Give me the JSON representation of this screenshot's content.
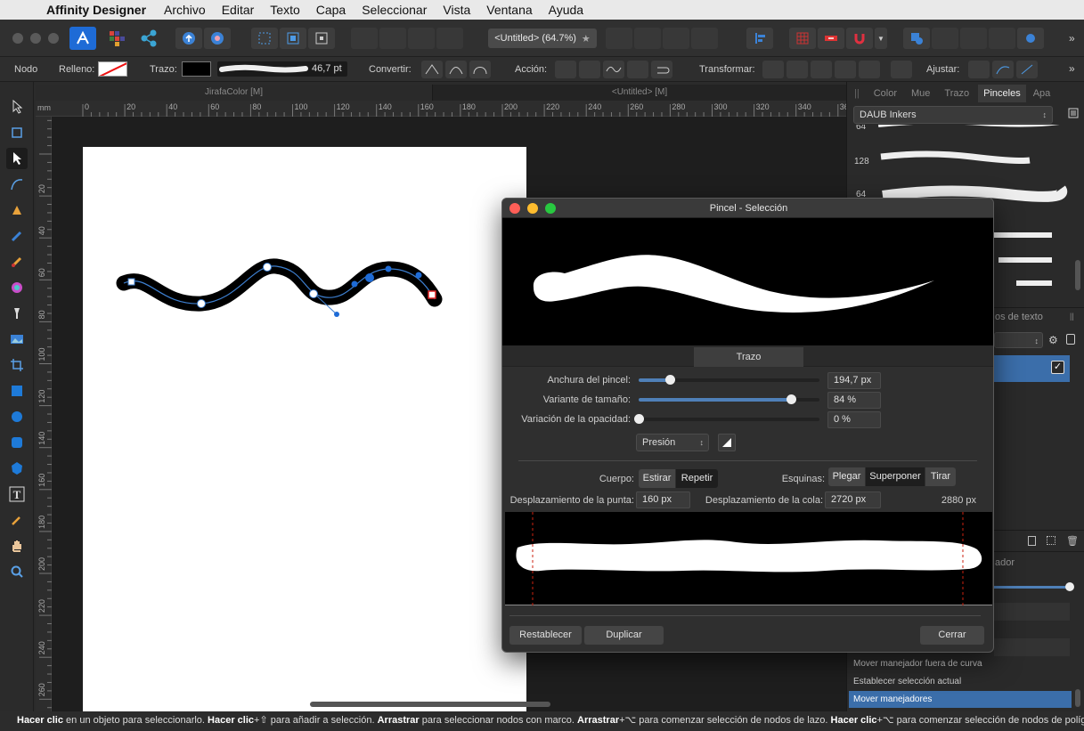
{
  "menubar": {
    "app": "Affinity Designer",
    "items": [
      "Archivo",
      "Editar",
      "Texto",
      "Capa",
      "Seleccionar",
      "Vista",
      "Ventana",
      "Ayuda"
    ]
  },
  "toolbar": {
    "document_tab": "<Untitled> (64.7%)"
  },
  "context_bar": {
    "node_label": "Nodo",
    "fill_label": "Relleno:",
    "stroke_label": "Trazo:",
    "stroke_width": "46,7 pt",
    "convert_label": "Convertir:",
    "action_label": "Acción:",
    "transform_label": "Transformar:",
    "snap_label": "Ajustar:"
  },
  "document_tabs": [
    "JirafaColor [M]",
    "<Untitled> [M]"
  ],
  "ruler": {
    "unit": "mm",
    "h_ticks": [
      "0",
      "20",
      "40",
      "60",
      "80",
      "100",
      "120",
      "140",
      "160",
      "180",
      "200",
      "220",
      "240",
      "260",
      "280",
      "300",
      "320",
      "340",
      "36"
    ],
    "v_ticks": [
      "20",
      "40",
      "60",
      "80",
      "100",
      "120",
      "140",
      "160",
      "180",
      "200",
      "220",
      "240",
      "260"
    ]
  },
  "right_panel": {
    "tabs": [
      "Color",
      "Mue",
      "Trazo",
      "Pinceles",
      "Apa"
    ],
    "active_tab": "Pinceles",
    "category": "DAUB Inkers",
    "brush_sizes": [
      "64",
      "128",
      "64"
    ],
    "partial_tab_label": "os de texto",
    "partial_label_2": "ador",
    "history": [
      "Mover manejador fuera de curva",
      "Establecer selección actual",
      "Mover manejadores"
    ]
  },
  "dialog": {
    "title": "Pincel - Selección",
    "tab": "Trazo",
    "brush_width_label": "Anchura del pincel:",
    "brush_width_value": "194,7 px",
    "brush_width_level": 0.17,
    "size_variance_label": "Variante de tamaño:",
    "size_variance_value": "84 %",
    "size_variance_level": 0.84,
    "opacity_variance_label": "Variación de la opacidad:",
    "opacity_variance_value": "0 %",
    "opacity_variance_level": 0.0,
    "pressure": "Presión",
    "body_label": "Cuerpo:",
    "body_options": [
      "Estirar",
      "Repetir"
    ],
    "body_selected": "Repetir",
    "corners_label": "Esquinas:",
    "corners_options": [
      "Plegar",
      "Superponer",
      "Tirar"
    ],
    "corners_selected": "Superponer",
    "head_offset_label": "Desplazamiento de la punta:",
    "head_offset_value": "160 px",
    "tail_offset_label": "Desplazamiento de la cola:",
    "tail_offset_value": "2720 px",
    "total_length": "2880 px",
    "reset_button": "Restablecer",
    "duplicate_button": "Duplicar",
    "close_button": "Cerrar"
  },
  "status": {
    "parts": [
      {
        "b": "Hacer clic",
        "t": " en un objeto para seleccionarlo. "
      },
      {
        "b": "Hacer clic",
        "t": "+⇧ para añadir a selección. "
      },
      {
        "b": "Arrastrar",
        "t": " para seleccionar nodos con marco. "
      },
      {
        "b": "Arrastrar",
        "t": "+⌥ para comenzar selección de nodos de lazo. "
      },
      {
        "b": "Hacer clic",
        "t": "+⌥ para comenzar selección de nodos de polígono."
      }
    ]
  },
  "colors": {
    "accent": "#3b6eaa",
    "affinity_blue": "#1e6bd6",
    "close_red": "#ff5f57",
    "minimize_yellow": "#febc2e",
    "zoom_green": "#28c840"
  }
}
